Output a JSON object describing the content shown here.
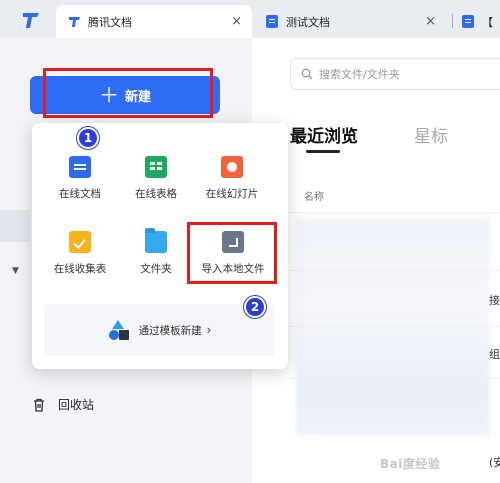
{
  "tabs": [
    {
      "title": "腾讯文档",
      "close": "×"
    },
    {
      "title": "测试文档",
      "close": "×"
    },
    {
      "title": "【"
    }
  ],
  "sidebar": {
    "new_button_label": "新建",
    "new_button_icon": "＋",
    "tree_caret": "▼",
    "trash_label": "回收站"
  },
  "search": {
    "placeholder": "搜索文件/文件夹"
  },
  "main": {
    "tab_recent": "最近浏览",
    "tab_starred": "星标",
    "column_name": "名称",
    "row_fragments": [
      "接",
      "组",
      "(安"
    ]
  },
  "new_menu": {
    "items": [
      {
        "label": "在线文档",
        "icon": "doc-icon"
      },
      {
        "label": "在线表格",
        "icon": "sheet-icon"
      },
      {
        "label": "在线幻灯片",
        "icon": "slides-icon"
      },
      {
        "label": "在线收集表",
        "icon": "form-icon"
      },
      {
        "label": "文件夹",
        "icon": "folder-icon"
      },
      {
        "label": "导入本地文件",
        "icon": "import-icon"
      }
    ],
    "template_label": "通过模板新建",
    "template_arrow": "›"
  },
  "badges": [
    "1",
    "2"
  ],
  "watermark": "Bai度经验",
  "colors": {
    "accent": "#2f6cf6",
    "highlight_box": "#e21e1e",
    "badge": "#2d3fd1"
  }
}
